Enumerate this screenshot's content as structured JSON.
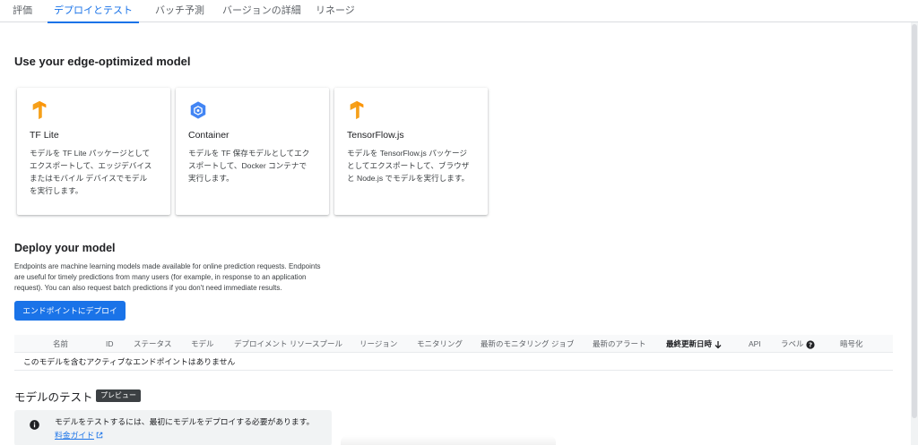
{
  "tabs": [
    {
      "label": "評価"
    },
    {
      "label": "デプロイとテスト",
      "active": true
    },
    {
      "label": "バッチ予測"
    },
    {
      "label": "バージョンの詳細"
    },
    {
      "label": "リネージ"
    }
  ],
  "edge": {
    "heading": "Use your edge-optimized model",
    "cards": [
      {
        "title": "TF Lite",
        "icon": "tensorflow-icon",
        "desc_lines": [
          "モデルを TF Lite パッケージとして",
          "エクスポートして、エッジデバイス",
          "またはモバイル デバイスでモデル",
          "を実行します。"
        ]
      },
      {
        "title": "Container",
        "icon": "container-icon",
        "desc_lines": [
          "モデルを TF 保存モデルとしてエク",
          "スポートして、Docker コンテナで",
          "実行します。"
        ]
      },
      {
        "title": "TensorFlow.js",
        "icon": "tensorflow-icon",
        "desc_lines": [
          "モデルを TensorFlow.js パッケージ",
          "としてエクスポートして、ブラウザ",
          "と Node.js でモデルを実行します。"
        ]
      }
    ]
  },
  "deploy": {
    "heading": "Deploy your model",
    "description_lines": [
      "Endpoints are machine learning models made available for online prediction requests. Endpoints",
      "are useful for timely predictions from many users (for example, in response to an application",
      "request). You can also request batch predictions if you don't need immediate results."
    ],
    "button_label": "エンドポイントにデプロイ"
  },
  "table": {
    "columns": [
      "名前",
      "ID",
      "ステータス",
      "モデル",
      "デプロイメント リソースプール",
      "リージョン",
      "モニタリング",
      "最新のモニタリング ジョブ",
      "最新のアラート",
      "最終更新日時",
      "API",
      "ラベル",
      "暗号化"
    ],
    "sort_column": "最終更新日時",
    "empty_message": "このモデルを含むアクティブなエンドポイントはありません"
  },
  "test": {
    "heading": "モデルのテスト",
    "badge": "プレビュー",
    "info_text": "モデルをテストするには、最初にモデルをデプロイする必要があります。",
    "link_label": "料金ガイド"
  },
  "colors": {
    "accent": "#1a73e8",
    "tensorflow_orange": "#f6a01a",
    "container_blue": "#4285f4"
  }
}
